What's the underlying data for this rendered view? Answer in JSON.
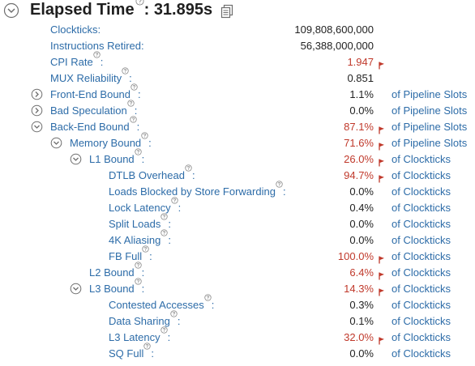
{
  "header": {
    "title": "Elapsed Time",
    "colon": ":",
    "value": "31.895s"
  },
  "rows": [
    {
      "label": "Clockticks:",
      "value": "109,808,600,000",
      "unit": "",
      "flagged": false,
      "help": false,
      "toggle": false,
      "indent": 0
    },
    {
      "label": "Instructions Retired:",
      "value": "56,388,000,000",
      "unit": "",
      "flagged": false,
      "help": false,
      "toggle": false,
      "indent": 0
    },
    {
      "label": "CPI Rate",
      "value": "1.947",
      "unit": "",
      "flagged": true,
      "help": true,
      "toggle": false,
      "indent": 0
    },
    {
      "label": "MUX Reliability",
      "value": "0.851",
      "unit": "",
      "flagged": false,
      "help": true,
      "toggle": false,
      "indent": 0
    },
    {
      "label": "Front-End Bound",
      "value": "1.1%",
      "unit": "of Pipeline Slots",
      "flagged": false,
      "help": true,
      "toggle": "collapsed",
      "indent": 0
    },
    {
      "label": "Bad Speculation",
      "value": "0.0%",
      "unit": "of Pipeline Slots",
      "flagged": false,
      "help": true,
      "toggle": "collapsed",
      "indent": 0
    },
    {
      "label": "Back-End Bound",
      "value": "87.1%",
      "unit": "of Pipeline Slots",
      "flagged": true,
      "help": true,
      "toggle": "expanded",
      "indent": 0
    },
    {
      "label": "Memory Bound",
      "value": "71.6%",
      "unit": "of Pipeline Slots",
      "flagged": true,
      "help": true,
      "toggle": "expanded",
      "indent": 1
    },
    {
      "label": "L1 Bound",
      "value": "26.0%",
      "unit": "of Clockticks",
      "flagged": true,
      "help": true,
      "toggle": "expanded",
      "indent": 2
    },
    {
      "label": "DTLB Overhead",
      "value": "94.7%",
      "unit": "of Clockticks",
      "flagged": true,
      "help": true,
      "toggle": false,
      "indent": 3
    },
    {
      "label": "Loads Blocked by Store Forwarding",
      "value": "0.0%",
      "unit": "of Clockticks",
      "flagged": false,
      "help": true,
      "toggle": false,
      "indent": 3
    },
    {
      "label": "Lock Latency",
      "value": "0.4%",
      "unit": "of Clockticks",
      "flagged": false,
      "help": true,
      "toggle": false,
      "indent": 3
    },
    {
      "label": "Split Loads",
      "value": "0.0%",
      "unit": "of Clockticks",
      "flagged": false,
      "help": true,
      "toggle": false,
      "indent": 3
    },
    {
      "label": "4K Aliasing",
      "value": "0.0%",
      "unit": "of Clockticks",
      "flagged": false,
      "help": true,
      "toggle": false,
      "indent": 3
    },
    {
      "label": "FB Full",
      "value": "100.0%",
      "unit": "of Clockticks",
      "flagged": true,
      "help": true,
      "toggle": false,
      "indent": 3
    },
    {
      "label": "L2 Bound",
      "value": "6.4%",
      "unit": "of Clockticks",
      "flagged": true,
      "help": true,
      "toggle": false,
      "indent": 2
    },
    {
      "label": "L3 Bound",
      "value": "14.3%",
      "unit": "of Clockticks",
      "flagged": true,
      "help": true,
      "toggle": "expanded",
      "indent": 2
    },
    {
      "label": "Contested Accesses",
      "value": "0.3%",
      "unit": "of Clockticks",
      "flagged": false,
      "help": true,
      "toggle": false,
      "indent": 3
    },
    {
      "label": "Data Sharing",
      "value": "0.1%",
      "unit": "of Clockticks",
      "flagged": false,
      "help": true,
      "toggle": false,
      "indent": 3
    },
    {
      "label": "L3 Latency",
      "value": "32.0%",
      "unit": "of Clockticks",
      "flagged": true,
      "help": true,
      "toggle": false,
      "indent": 3
    },
    {
      "label": "SQ Full",
      "value": "0.0%",
      "unit": "of Clockticks",
      "flagged": false,
      "help": true,
      "toggle": false,
      "indent": 3
    }
  ],
  "colors": {
    "label": "#2d6ca8",
    "value": "#222222",
    "flagged": "#c0392b"
  }
}
